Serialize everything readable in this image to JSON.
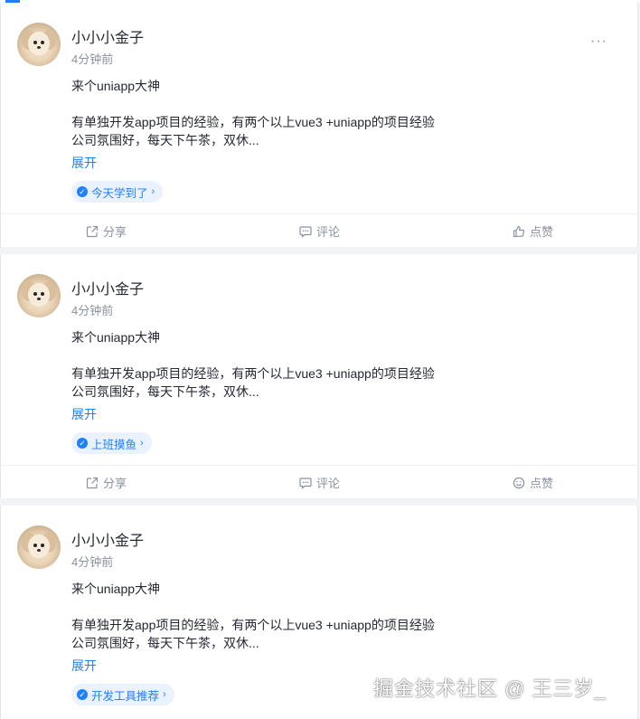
{
  "posts": [
    {
      "author": "小小小金子",
      "time": "4分钟前",
      "line1": "来个uniapp大神",
      "line2": "有单独开发app项目的经验，有两个以上vue3 +uniapp的项目经验",
      "line3": "公司氛围好，每天下午茶，双休...",
      "expand": "展开",
      "tag": "今天学到了",
      "actions": {
        "share": "分享",
        "comment": "评论",
        "like": "点赞"
      }
    },
    {
      "author": "小小小金子",
      "time": "4分钟前",
      "line1": "来个uniapp大神",
      "line2": "有单独开发app项目的经验，有两个以上vue3 +uniapp的项目经验",
      "line3": "公司氛围好，每天下午茶，双休...",
      "expand": "展开",
      "tag": "上班摸鱼",
      "actions": {
        "share": "分享",
        "comment": "评论",
        "like": "点赞"
      }
    },
    {
      "author": "小小小金子",
      "time": "4分钟前",
      "line1": "来个uniapp大神",
      "line2": "有单独开发app项目的经验，有两个以上vue3 +uniapp的项目经验",
      "line3": "公司氛围好，每天下午茶，双休...",
      "expand": "展开",
      "tag": "开发工具推荐"
    }
  ],
  "more_icon": "···",
  "watermark": "掘金技术社区 @ 王三岁_",
  "colors": {
    "accent": "#1e80ff",
    "tag_bg": "#eaf2ff",
    "muted": "#8a919f",
    "text": "#252933"
  }
}
